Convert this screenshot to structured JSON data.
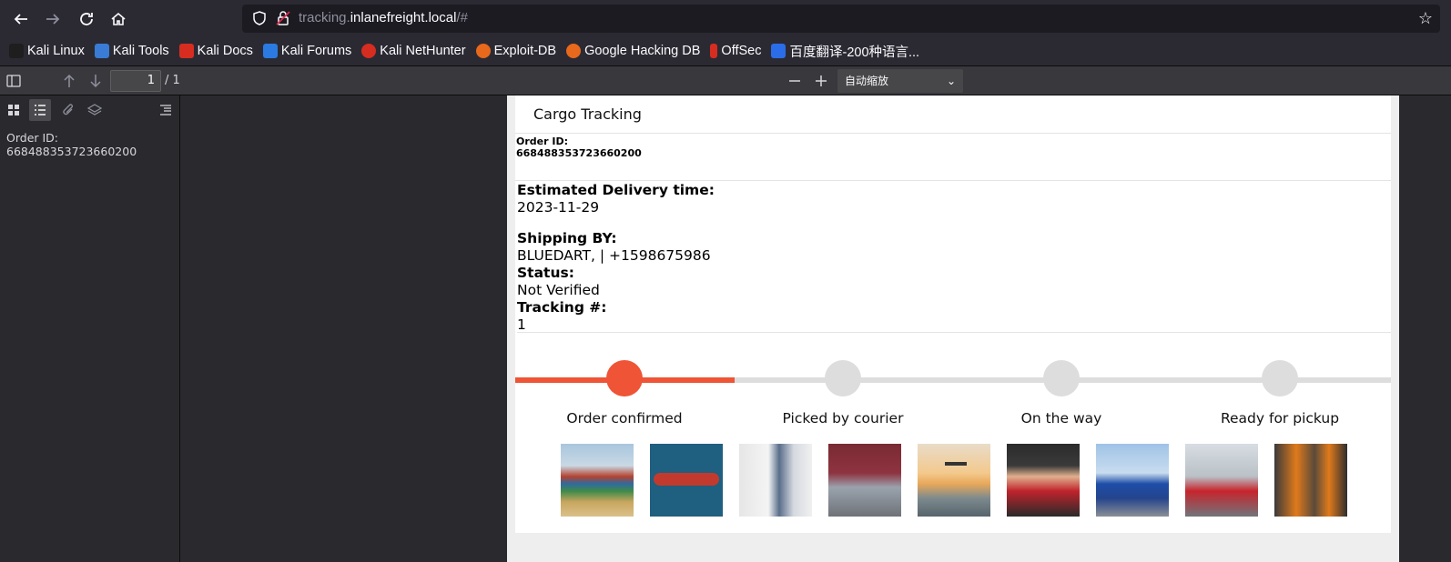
{
  "browser": {
    "url_prefix": "tracking.",
    "url_domain": "inlanefreight.local",
    "url_suffix": "/#"
  },
  "bookmarks": [
    {
      "label": "Kali Linux",
      "icon": "kali-dragon-icon",
      "color": "#1e1e1e"
    },
    {
      "label": "Kali Tools",
      "icon": "kali-tools-icon",
      "color": "#3a7bd5"
    },
    {
      "label": "Kali Docs",
      "icon": "kali-docs-icon",
      "color": "#d62d20"
    },
    {
      "label": "Kali Forums",
      "icon": "kali-forums-icon",
      "color": "#2a7ae2"
    },
    {
      "label": "Kali NetHunter",
      "icon": "nethunter-icon",
      "color": "#d62d20"
    },
    {
      "label": "Exploit-DB",
      "icon": "exploit-db-icon",
      "color": "#e8691c"
    },
    {
      "label": "Google Hacking DB",
      "icon": "ghdb-icon",
      "color": "#e8691c"
    },
    {
      "label": "OffSec",
      "icon": "offsec-icon",
      "color": "#d62d20"
    },
    {
      "label": "百度翻译-200种语言...",
      "icon": "baidu-translate-icon",
      "color": "#2b6de8"
    }
  ],
  "pdf_toolbar": {
    "page_number": "1",
    "page_total": "/ 1",
    "zoom": "自动缩放"
  },
  "sidebar": {
    "outline_text": "Order ID: 668488353723660200"
  },
  "document": {
    "title": "Cargo Tracking",
    "order_label": "Order ID:",
    "order_id": "668488353723660200",
    "delivery_label": "Estimated Delivery time:",
    "delivery_value": "2023-11-29",
    "shipping_label": "Shipping BY:",
    "shipping_value": "BLUEDART, | +1598675986",
    "status_label": "Status:",
    "status_value": "Not Verified",
    "tracking_label": "Tracking #:",
    "tracking_value": "1",
    "steps": [
      {
        "label": "Order confirmed",
        "done": true
      },
      {
        "label": "Picked by courier",
        "done": false
      },
      {
        "label": "On the way",
        "done": false
      },
      {
        "label": "Ready for pickup",
        "done": false
      }
    ],
    "progress_fraction": 0.25,
    "accent_color": "#ee5435",
    "gallery": [
      "containers-image",
      "cargo-ship-image",
      "trucker-image",
      "red-truck-image",
      "airplane-image",
      "driver-image",
      "blue-trucks-image",
      "red-trucks-image",
      "workers-image"
    ]
  }
}
